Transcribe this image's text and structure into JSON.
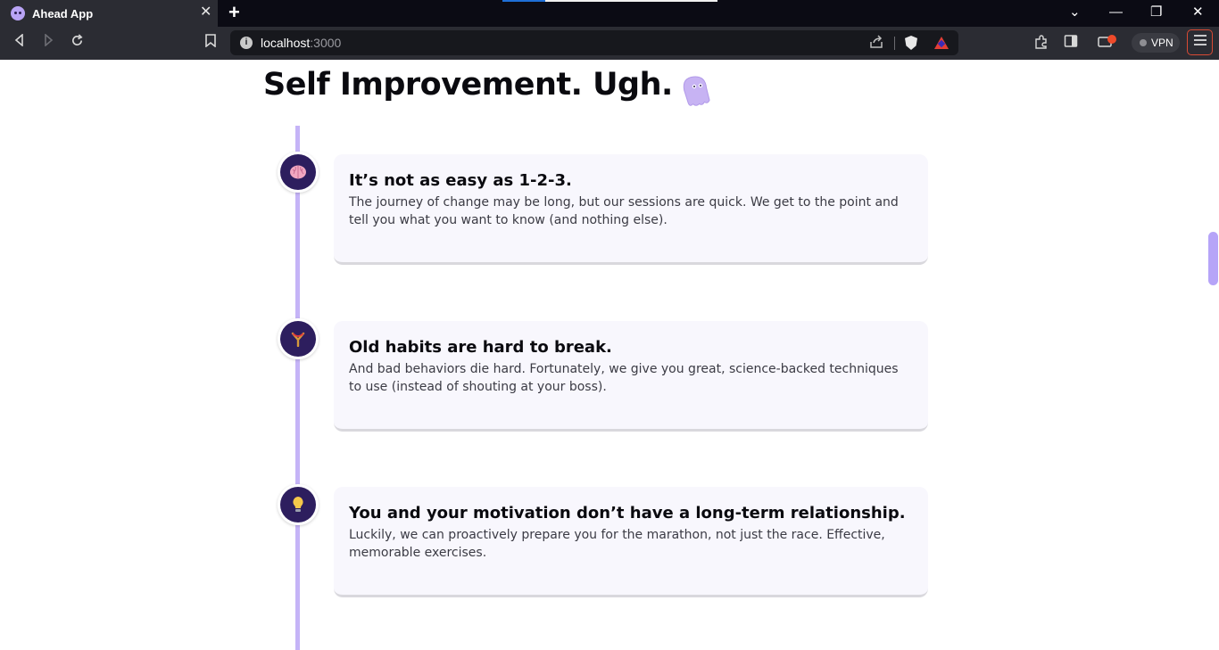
{
  "browser": {
    "tab_title": "Ahead App",
    "tab_close": "✕",
    "new_tab": "+",
    "window_controls": {
      "dropdown": "⌄",
      "minimize": "—",
      "restore": "❐",
      "close": "✕"
    },
    "url_host": "localhost",
    "url_port": ":3000",
    "vpn_label": "VPN"
  },
  "page": {
    "headline": "Self Improvement. Ugh.",
    "items": [
      {
        "icon": "brain-icon",
        "title": "It’s not as easy as 1-2-3.",
        "text": "The journey of change may be long, but our sessions are quick. We get to the point and tell you what you want to know (and nothing else)."
      },
      {
        "icon": "slingshot-icon",
        "title": "Old habits are hard to break.",
        "text": "And bad behaviors die hard. Fortunately, we give you great, science-backed techniques to use (instead of shouting at your boss)."
      },
      {
        "icon": "lightbulb-icon",
        "title": "You and your motivation don’t have a long-term relationship.",
        "text": "Luckily, we can proactively prepare you for the marathon, not just the race. Effective, memorable exercises."
      }
    ]
  },
  "colors": {
    "accent": "#c5b4f7",
    "node_bg": "#2d1e5e",
    "card_bg": "#f8f7fd",
    "scrollbar": "#b6a4f8"
  }
}
